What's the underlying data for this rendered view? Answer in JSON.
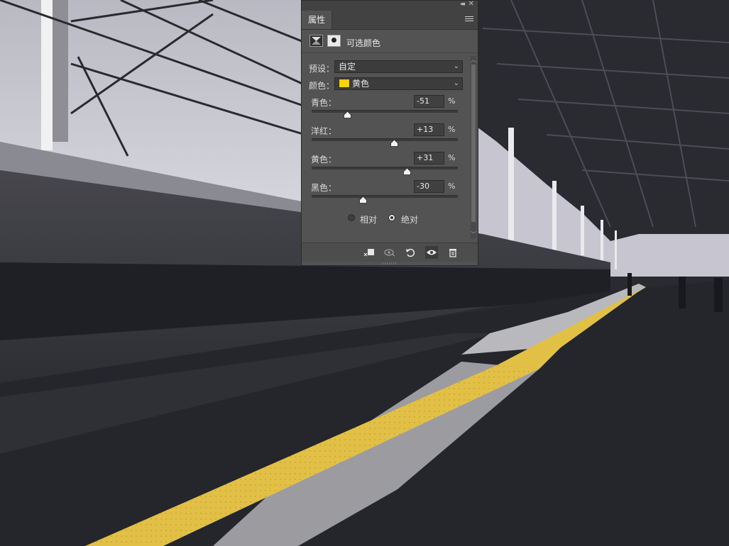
{
  "panel": {
    "tab_label": "属性",
    "title": "可选颜色",
    "preset_label": "预设：",
    "preset_value": "自定",
    "color_label": "颜色：",
    "color_value": "黄色",
    "color_swatch": "#ffd200",
    "sliders": [
      {
        "label": "青色：",
        "value": "-51",
        "unit": "%",
        "level": -51
      },
      {
        "label": "洋红：",
        "value": "+13",
        "unit": "%",
        "level": 13
      },
      {
        "label": "黄色：",
        "value": "+31",
        "unit": "%",
        "level": 31
      },
      {
        "label": "黑色：",
        "value": "-30",
        "unit": "%",
        "level": -30
      }
    ],
    "method": {
      "relative_label": "相对",
      "absolute_label": "绝对",
      "selected": "absolute"
    },
    "footer_icons": [
      "clip-to-layer-icon",
      "view-previous-state-icon",
      "reset-icon",
      "visibility-eye-icon",
      "trash-icon"
    ]
  }
}
